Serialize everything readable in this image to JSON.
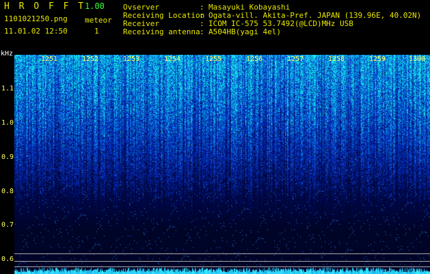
{
  "header": {
    "app_name": "H R O F F T",
    "version": "1.00",
    "filename": "1101021250.png",
    "datetime": "11.01.02 12:50",
    "meteor_label": "meteor",
    "meteor_count": "1"
  },
  "info": {
    "labels": [
      "Ovserver",
      "Receiving Location",
      "Receiver",
      "Receiving antenna"
    ],
    "separators": [
      ":",
      ":",
      ":",
      ":"
    ],
    "values": [
      "Masayuki Kobayashi",
      "Ogata-vill. Akita-Pref. JAPAN (139.96E, 40.02N)",
      "ICOM IC-575 53.7492(@LCD)MHz USB",
      "A504HB(yagi 4el)"
    ]
  },
  "axis": {
    "unit": "kHz",
    "y_ticks": [
      "1.1",
      "1.0",
      "0.9",
      "0.8",
      "0.7",
      "0.6"
    ],
    "x_ticks": [
      "1251",
      "1252",
      "1253",
      "1254",
      "1255",
      "1256",
      "1257",
      "1258",
      "1259",
      "1300"
    ]
  },
  "colors": {
    "background": "#000000",
    "header_yellow": "#e8e800",
    "header_green": "#33ff33",
    "spectrogram_deep": "#000833",
    "spectrogram_mid": "#0a2aa0",
    "spectrogram_bright": "#20e0ff"
  }
}
